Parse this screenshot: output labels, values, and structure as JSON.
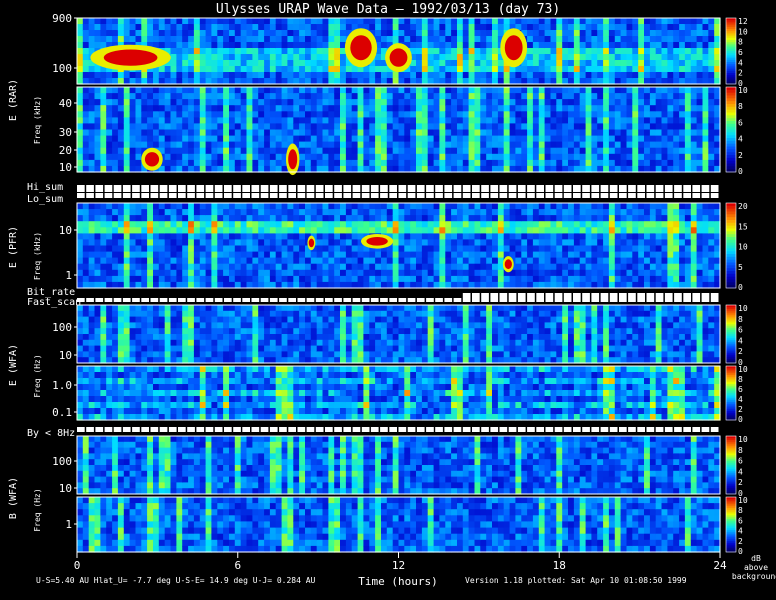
{
  "chart_data": {
    "type": "heatmap",
    "title": "Ulysses URAP Wave Data — 1992/03/13  (day 73)",
    "xlabel": "Time (hours)",
    "x_ticks": [
      "0",
      "6",
      "12",
      "18",
      "24"
    ],
    "xlim": [
      0,
      24
    ],
    "panel_groups": [
      {
        "label": "E (RAR)",
        "sublabel": "Freq (kHz)"
      },
      {
        "label": "E (PFR)",
        "sublabel": "Freq (kHz)"
      },
      {
        "label": "E (WFA)",
        "sublabel": "Freq (Hz)"
      },
      {
        "label": "B (WFA)",
        "sublabel": "Freq (Hz)"
      }
    ],
    "status_rows": [
      "Hi_sum",
      "Lo_sum",
      "Bit_rate",
      "Fast_scan",
      "By < 8Hz"
    ],
    "panels": [
      {
        "name": "rar-high",
        "y_ticks": [
          "900",
          "100"
        ],
        "scale": "log",
        "cbar_ticks": [
          "12",
          "10",
          "8",
          "6",
          "4",
          "2",
          "0"
        ],
        "cbar_max": 12,
        "events": [
          {
            "t": 0.5,
            "f": 0.6,
            "w": 3.0,
            "h": 0.3
          },
          {
            "t": 10.0,
            "f": 0.45,
            "w": 1.2,
            "h": 0.5
          },
          {
            "t": 11.5,
            "f": 0.6,
            "w": 1.0,
            "h": 0.35
          },
          {
            "t": 15.8,
            "f": 0.45,
            "w": 1.0,
            "h": 0.5
          }
        ]
      },
      {
        "name": "rar-low",
        "y_ticks": [
          "40",
          "30",
          "20",
          "10"
        ],
        "scale": "linear",
        "cbar_ticks": [
          "10",
          "8",
          "6",
          "4",
          "2",
          "0"
        ],
        "cbar_max": 10,
        "events": [
          {
            "t": 2.4,
            "f": 0.85,
            "w": 0.8,
            "h": 0.2
          },
          {
            "t": 7.8,
            "f": 0.85,
            "w": 0.5,
            "h": 0.3
          }
        ]
      },
      {
        "name": "pfr",
        "y_ticks": [
          "10",
          "1"
        ],
        "scale": "log",
        "cbar_ticks": [
          "20",
          "15",
          "10",
          "5",
          "0"
        ],
        "cbar_max": 20,
        "events": [
          {
            "t": 8.6,
            "f": 0.47,
            "w": 0.3,
            "h": 0.1
          },
          {
            "t": 10.6,
            "f": 0.45,
            "w": 1.2,
            "h": 0.1
          },
          {
            "t": 15.9,
            "f": 0.72,
            "w": 0.4,
            "h": 0.12
          }
        ]
      },
      {
        "name": "e-wfa-high",
        "y_ticks": [
          "100",
          "10"
        ],
        "scale": "log",
        "cbar_ticks": [
          "10",
          "8",
          "6",
          "4",
          "2",
          "0"
        ],
        "cbar_max": 10,
        "events": []
      },
      {
        "name": "e-wfa-low",
        "y_ticks": [
          "1.0",
          "0.1"
        ],
        "scale": "log",
        "cbar_ticks": [
          "10",
          "8",
          "6",
          "4",
          "2",
          "0"
        ],
        "cbar_max": 10,
        "events": []
      },
      {
        "name": "b-wfa-high",
        "y_ticks": [
          "100",
          "10"
        ],
        "scale": "log",
        "cbar_ticks": [
          "10",
          "8",
          "6",
          "4",
          "2",
          "0"
        ],
        "cbar_max": 10,
        "events": []
      },
      {
        "name": "b-wfa-low",
        "y_ticks": [
          "1"
        ],
        "scale": "log",
        "cbar_ticks": [
          "10",
          "8",
          "6",
          "4",
          "2",
          "0"
        ],
        "cbar_max": 10,
        "events": []
      }
    ],
    "cbar_unit_lines": [
      "dB",
      "above",
      "background"
    ]
  },
  "footer": {
    "ephemeris": "U-S=5.40 AU  Hlat_U= -7.7 deg  U-S-E= 14.9 deg  U-J= 0.284 AU",
    "version": "Version 1.18 plotted: Sat Apr 10 01:08:50 1999"
  }
}
